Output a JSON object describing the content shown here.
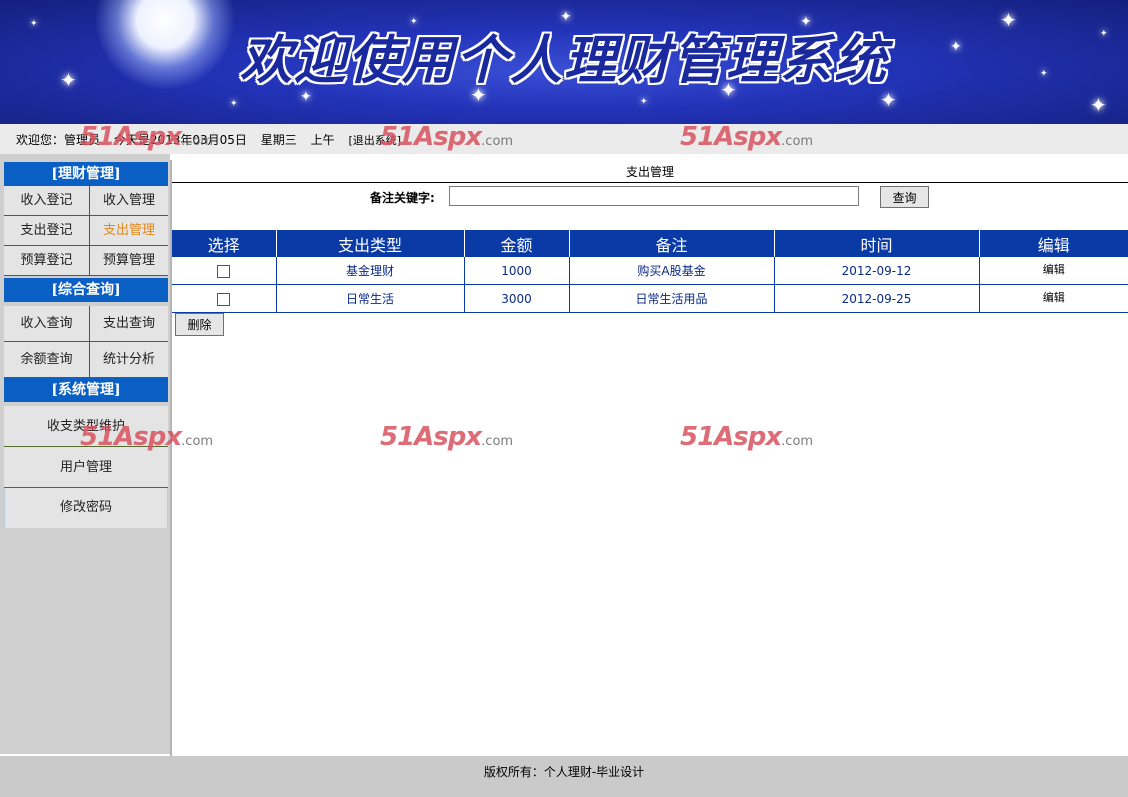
{
  "banner": {
    "title": "欢迎使用个人理财管理系统"
  },
  "infobar": {
    "welcome": "欢迎您：管理员",
    "date": "今天是2013年03月05日",
    "weekday": "星期三",
    "period": "上午",
    "logout": "[退出系统]"
  },
  "sidebar": {
    "sections": [
      {
        "title": "[理财管理]",
        "items": [
          "收入登记",
          "收入管理",
          "支出登记",
          "支出管理",
          "预算登记",
          "预算管理"
        ]
      },
      {
        "title": "[综合查询]",
        "items": [
          "收入查询",
          "支出查询",
          "余额查询",
          "统计分析"
        ]
      },
      {
        "title": "[系统管理]",
        "items": [
          "收支类型维护",
          "用户管理",
          "修改密码"
        ]
      }
    ],
    "active_item": "支出管理",
    "active_color": "#e08a1e"
  },
  "main": {
    "title": "支出管理",
    "search": {
      "label": "备注关键字:",
      "value": "",
      "button": "查询"
    },
    "table": {
      "columns": [
        "选择",
        "支出类型",
        "金额",
        "备注",
        "时间",
        "编辑"
      ],
      "rows": [
        {
          "type": "基金理财",
          "amount": "1000",
          "note": "购买A股基金",
          "time": "2012-09-12",
          "edit": "编辑",
          "checked": false
        },
        {
          "type": "日常生活",
          "amount": "3000",
          "note": "日常生活用品",
          "time": "2012-09-25",
          "edit": "编辑",
          "checked": false
        }
      ],
      "header_color": "#0a3aa6"
    },
    "delete_button": "删除"
  },
  "footer": {
    "text": "版权所有：个人理财-毕业设计"
  },
  "watermark": {
    "main": "51Aspx",
    "suffix": ".com"
  }
}
